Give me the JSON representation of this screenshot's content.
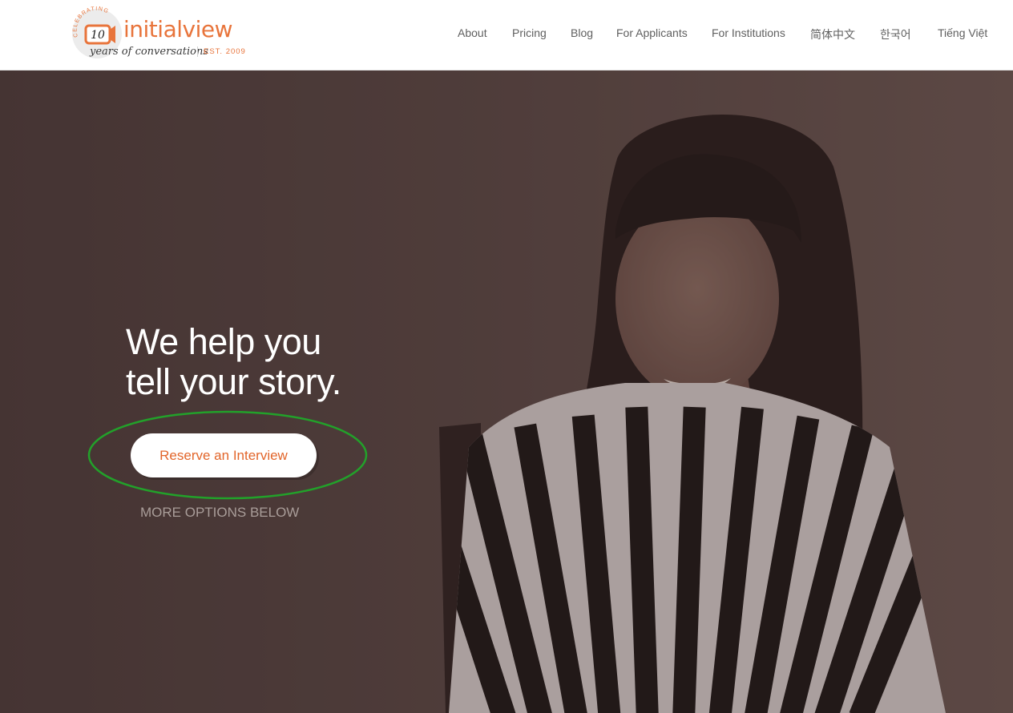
{
  "brand": {
    "badge_top": "CELEBRATING",
    "badge_number": "10",
    "name": "initialview",
    "tagline": "years of conversations",
    "established": "EST. 2009",
    "accent_color": "#e8743b"
  },
  "nav": {
    "items": [
      {
        "label": "About"
      },
      {
        "label": "Pricing"
      },
      {
        "label": "Blog"
      },
      {
        "label": "For Applicants"
      },
      {
        "label": "For Institutions"
      },
      {
        "label": "简体中文"
      },
      {
        "label": "한국어"
      },
      {
        "label": "Tiếng Việt"
      }
    ]
  },
  "hero": {
    "title_line1": "We help you",
    "title_line2": "tell your story.",
    "cta_label": "Reserve an Interview",
    "more_options": "MORE OPTIONS BELOW",
    "cta_text_color": "#e2652a",
    "highlight_color": "#22a12a"
  }
}
